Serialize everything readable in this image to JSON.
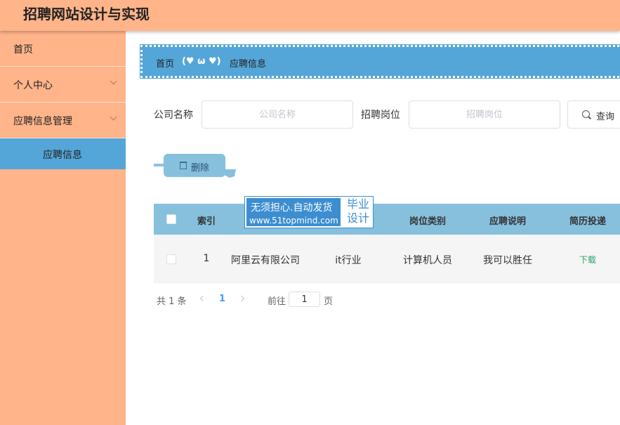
{
  "app": {
    "title": "招聘网站设计与实现"
  },
  "sidebar": {
    "items": [
      {
        "label": "首页"
      },
      {
        "label": "个人中心"
      },
      {
        "label": "应聘信息管理"
      }
    ],
    "sub_item": {
      "label": "应聘信息"
    }
  },
  "breadcrumb": {
    "home": "首页",
    "separator": "(♥ ω ♥)",
    "current": "应聘信息"
  },
  "search": {
    "company_label": "公司名称",
    "company_placeholder": "公司名称",
    "position_label": "招聘岗位",
    "position_placeholder": "招聘岗位",
    "query_button": "查询"
  },
  "actions": {
    "delete_button": "删除"
  },
  "table": {
    "columns": [
      "索引",
      "岗位类别",
      "应聘说明",
      "简历投递"
    ],
    "rows": [
      {
        "index": "1",
        "company": "阿里云有限公司",
        "industry": "it行业",
        "category": "计算机人员",
        "description": "我可以胜任",
        "resume": "下载"
      }
    ]
  },
  "pagination": {
    "total": "共 1 条",
    "current_page": "1",
    "goto_label": "前往",
    "goto_value": "1",
    "page_suffix": "页"
  },
  "watermark": {
    "line1": "无须担心.自动发货",
    "line2": "www.51topmind.com",
    "right_line1": "毕业",
    "right_line2": "设计"
  },
  "colors": {
    "header_bg": "#ffb48a",
    "accent_blue": "#54a6d8",
    "table_head": "#86c0dd",
    "download_link": "#26a269"
  }
}
